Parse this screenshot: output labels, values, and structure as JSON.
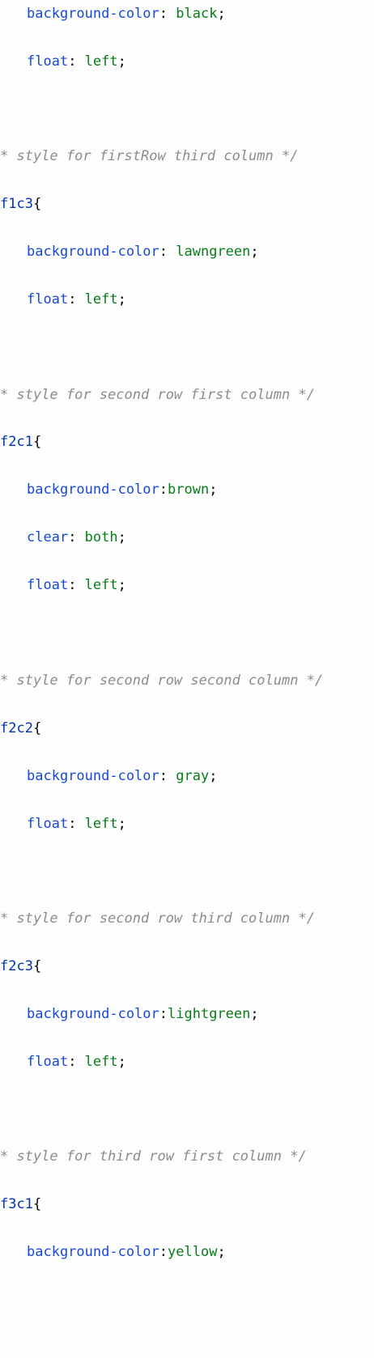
{
  "editor": {
    "language": "css",
    "colors": {
      "background": "#fdfdfd",
      "comment": "#8c8c8c",
      "selector": "#0033b3",
      "property": "#174ad4",
      "value": "#067d17"
    },
    "lines": [
      {
        "type": "prop",
        "property": "background-color",
        "separator": ": ",
        "value": "black",
        "end": ";"
      },
      {
        "type": "prop",
        "property": "float",
        "separator": ": ",
        "value": "left",
        "end": ";"
      },
      {
        "type": "comment",
        "text": "* style for firstRow third column */"
      },
      {
        "type": "selector",
        "text": "f1c3",
        "brace": "{"
      },
      {
        "type": "prop",
        "property": "background-color",
        "separator": ": ",
        "value": "lawngreen",
        "end": ";"
      },
      {
        "type": "prop",
        "property": "float",
        "separator": ": ",
        "value": "left",
        "end": ";"
      },
      {
        "type": "comment",
        "text": "* style for second row first column */"
      },
      {
        "type": "selector",
        "text": "f2c1",
        "brace": "{"
      },
      {
        "type": "prop",
        "property": "background-color",
        "separator": ":",
        "value": "brown",
        "end": ";"
      },
      {
        "type": "prop",
        "property": "clear",
        "separator": ": ",
        "value": "both",
        "end": ";"
      },
      {
        "type": "prop",
        "property": "float",
        "separator": ": ",
        "value": "left",
        "end": ";"
      },
      {
        "type": "comment",
        "text": "* style for second row second column */"
      },
      {
        "type": "selector",
        "text": "f2c2",
        "brace": "{"
      },
      {
        "type": "prop",
        "property": "background-color",
        "separator": ": ",
        "value": "gray",
        "end": ";"
      },
      {
        "type": "prop",
        "property": "float",
        "separator": ": ",
        "value": "left",
        "end": ";"
      },
      {
        "type": "comment",
        "text": "* style for second row third column */"
      },
      {
        "type": "selector",
        "text": "f2c3",
        "brace": "{"
      },
      {
        "type": "prop",
        "property": "background-color",
        "separator": ":",
        "value": "lightgreen",
        "end": ";"
      },
      {
        "type": "prop",
        "property": "float",
        "separator": ": ",
        "value": "left",
        "end": ";"
      },
      {
        "type": "comment",
        "text": "* style for third row first column */"
      },
      {
        "type": "selector",
        "text": "f3c1",
        "brace": "{"
      },
      {
        "type": "prop",
        "property": "background-color",
        "separator": ":",
        "value": "yellow",
        "end": ";"
      }
    ]
  }
}
